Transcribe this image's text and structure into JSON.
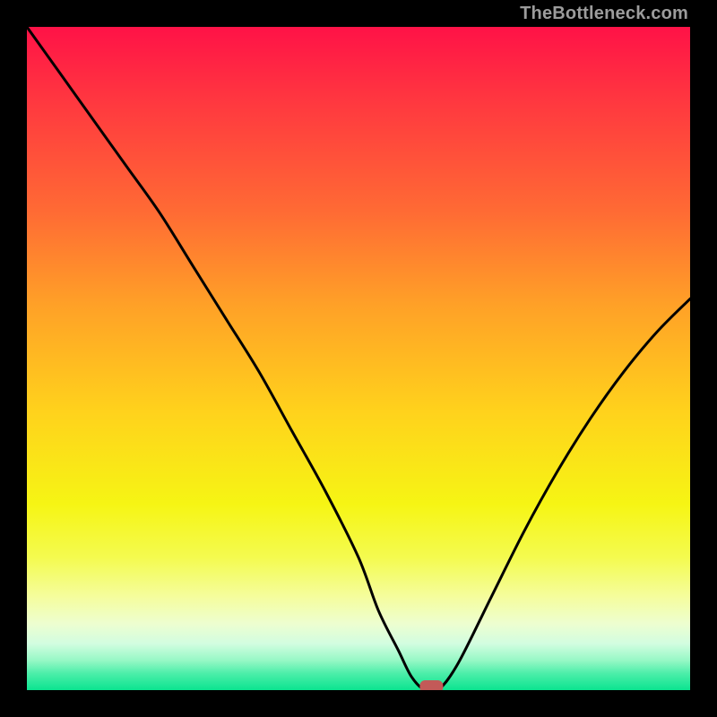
{
  "attribution": "TheBottleneck.com",
  "chart_data": {
    "type": "line",
    "title": "",
    "xlabel": "",
    "ylabel": "",
    "xlim": [
      0,
      100
    ],
    "ylim": [
      0,
      100
    ],
    "x": [
      0,
      5,
      10,
      15,
      20,
      25,
      30,
      35,
      40,
      45,
      50,
      53,
      56,
      58,
      60,
      62,
      65,
      70,
      75,
      80,
      85,
      90,
      95,
      100
    ],
    "values": [
      100,
      93,
      86,
      79,
      72,
      64,
      56,
      48,
      39,
      30,
      20,
      12,
      6,
      2,
      0,
      0,
      4,
      14,
      24,
      33,
      41,
      48,
      54,
      59
    ],
    "min_marker": {
      "x": 61,
      "y": 0
    },
    "gradient_stops": [
      {
        "offset": 0.0,
        "color": "#ff1247"
      },
      {
        "offset": 0.12,
        "color": "#ff3a3f"
      },
      {
        "offset": 0.28,
        "color": "#ff6b34"
      },
      {
        "offset": 0.42,
        "color": "#ffa127"
      },
      {
        "offset": 0.58,
        "color": "#ffd21c"
      },
      {
        "offset": 0.72,
        "color": "#f6f514"
      },
      {
        "offset": 0.8,
        "color": "#f4fb4f"
      },
      {
        "offset": 0.86,
        "color": "#f5fd9e"
      },
      {
        "offset": 0.9,
        "color": "#edfed0"
      },
      {
        "offset": 0.93,
        "color": "#d2fde0"
      },
      {
        "offset": 0.955,
        "color": "#97f8c6"
      },
      {
        "offset": 0.975,
        "color": "#4ceea9"
      },
      {
        "offset": 1.0,
        "color": "#0be490"
      }
    ]
  }
}
